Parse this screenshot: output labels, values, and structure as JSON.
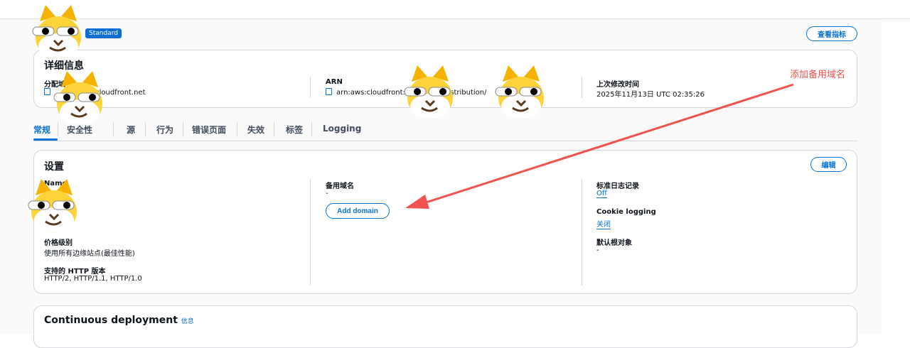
{
  "header": {
    "tier_badge": "Standard",
    "view_metrics_button": "查看指标"
  },
  "details": {
    "title": "详细信息",
    "distribution_domain": {
      "label": "分配域",
      "value": "t.cloudfront.net"
    },
    "arn": {
      "label": "ARN",
      "value": "arn:aws:cloudfront::",
      "value_tail": "stribution/"
    },
    "last_modified": {
      "label": "上次修改时间",
      "value": "2025年11月13日 UTC 02:35:26"
    }
  },
  "tabs": [
    {
      "label": "常规"
    },
    {
      "label": "安全性"
    },
    {
      "label": "源"
    },
    {
      "label": "行为"
    },
    {
      "label": "错误页面"
    },
    {
      "label": "失效"
    },
    {
      "label": "标签"
    },
    {
      "label": "Logging"
    }
  ],
  "settings": {
    "title": "设置",
    "edit_button": "编辑",
    "name_label": "Name",
    "price_class": {
      "label": "价格级别",
      "value": "使用所有边缘站点(最佳性能)"
    },
    "http_versions": {
      "label": "支持的 HTTP 版本",
      "value": "HTTP/2, HTTP/1.1, HTTP/1.0"
    },
    "alternate_domains": {
      "label": "备用域名",
      "value": "-",
      "add_button": "Add domain"
    },
    "standard_logging": {
      "label": "标准日志记录",
      "value": "Off"
    },
    "cookie_logging": {
      "label": "Cookie logging",
      "value": "关闭"
    },
    "default_root": {
      "label": "默认根对象",
      "value": "-"
    }
  },
  "continuous_deployment": {
    "title": "Continuous deployment",
    "info_link": "信息"
  },
  "annotation": {
    "text": "添加备用域名",
    "color": "#f0524f"
  }
}
